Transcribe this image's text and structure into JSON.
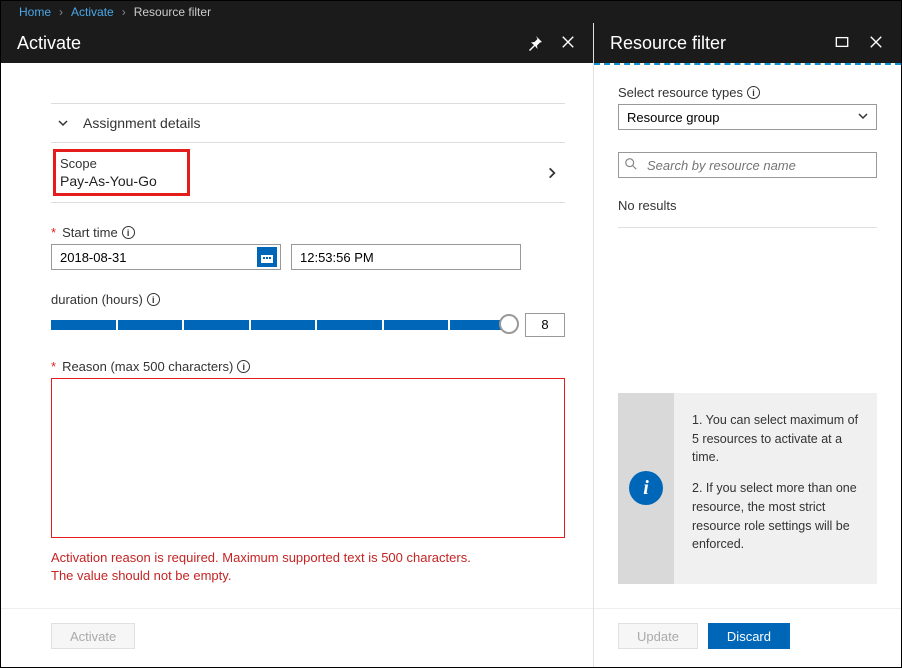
{
  "breadcrumb": {
    "home": "Home",
    "activate": "Activate",
    "current": "Resource filter"
  },
  "left": {
    "title": "Activate",
    "section": "Assignment details",
    "scope_label": "Scope",
    "scope_value": "Pay-As-You-Go",
    "start_time_label": "Start time",
    "date_value": "2018-08-31",
    "time_value": "12:53:56 PM",
    "duration_label": "duration (hours)",
    "duration_value": "8",
    "reason_label": "Reason (max 500 characters)",
    "error_line1": "Activation reason is required. Maximum supported text is 500 characters.",
    "error_line2": "The value should not be empty.",
    "activate_btn": "Activate"
  },
  "right": {
    "title": "Resource filter",
    "types_label": "Select resource types",
    "types_value": "Resource group",
    "search_placeholder": "Search by resource name",
    "no_results": "No results",
    "tip1": "1. You can select maximum of 5 resources to activate at a time.",
    "tip2": "2. If you select more than one resource, the most strict resource role settings will be enforced.",
    "update_btn": "Update",
    "discard_btn": "Discard"
  }
}
